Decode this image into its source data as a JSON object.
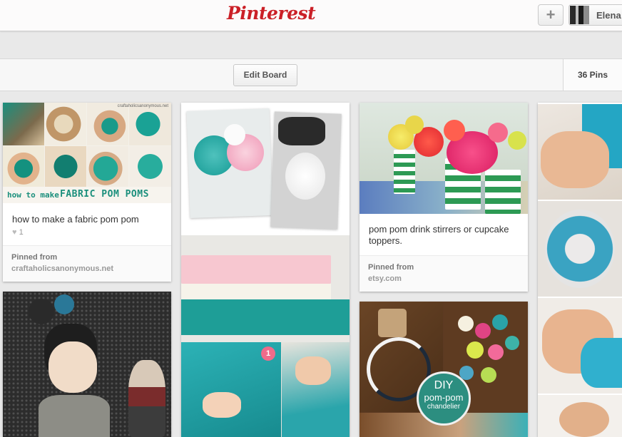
{
  "header": {
    "logo": "Pinterest",
    "add_icon": "plus-icon",
    "user_name": "Elena"
  },
  "board": {
    "edit_label": "Edit Board",
    "pins_count": "36 Pins"
  },
  "pins": {
    "pom_pom": {
      "overlay_small": "how to make",
      "overlay_big": "FABRIC POM POMS",
      "watermark": "craftaholicsanonymous.net",
      "description": "how to make a fabric pom pom",
      "likes": "1",
      "pinned_from_label": "Pinned from",
      "source": "craftaholicsanonymous.net"
    },
    "stirrers": {
      "description": "pom pom drink stirrers or cupcake toppers.",
      "pinned_from_label": "Pinned from",
      "source": "etsy.com"
    },
    "chandelier": {
      "badge_line1": "DIY",
      "badge_line2": "pom-pom",
      "badge_line3": "chandelier"
    },
    "tissue": {
      "step_badge": "1"
    }
  },
  "colors": {
    "brand": "#cb2027",
    "teal": "#1ea7a6",
    "pink": "#f07aa0"
  }
}
